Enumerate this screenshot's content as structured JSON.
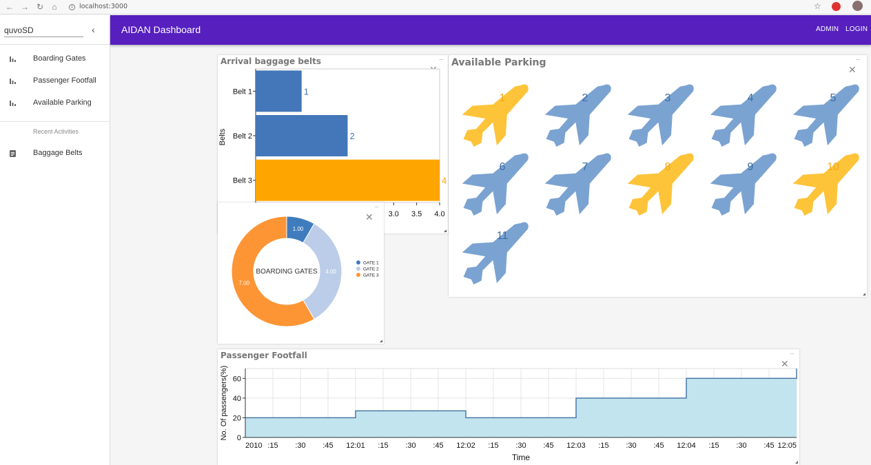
{
  "browser": {
    "url": "localhost:3000"
  },
  "sidebar": {
    "user": "quvoSD",
    "items": [
      {
        "label": "Boarding Gates",
        "icon": "bar-chart-icon"
      },
      {
        "label": "Passenger Footfall",
        "icon": "bar-chart-icon"
      },
      {
        "label": "Available Parking",
        "icon": "bar-chart-icon"
      }
    ],
    "section_title": "Recent Activities",
    "recent": [
      {
        "label": "Baggage Belts",
        "icon": "clipboard-icon"
      }
    ]
  },
  "appbar": {
    "title": "AIDAN Dashboard",
    "admin": "ADMIN",
    "login": "LOGIN",
    "color": "#561fbe"
  },
  "widgets": {
    "baggage": {
      "title": "Arrival baggage belts"
    },
    "parking": {
      "title": "Available Parking"
    },
    "gates": {
      "title": ""
    },
    "footfall": {
      "title": "Passenger Footfall"
    }
  },
  "chart_data": [
    {
      "type": "bar",
      "orientation": "horizontal",
      "title": "Arrival baggage belts",
      "ylabel": "Belts",
      "categories": [
        "Belt 1",
        "Belt 2",
        "Belt 3"
      ],
      "values": [
        1,
        2,
        4
      ],
      "colors": [
        "#4477b9",
        "#4477b9",
        "#ffa500"
      ],
      "xlim": [
        0,
        4.0
      ],
      "x_ticks_visible": [
        "3.0",
        "3.5",
        "4.0"
      ]
    },
    {
      "type": "pie",
      "variant": "donut",
      "center_label": "BOARDING GATES",
      "slices": [
        {
          "name": "GATE 1",
          "value": 1,
          "label": "1.00",
          "color": "#3f7cbd"
        },
        {
          "name": "GATE 2",
          "value": 4,
          "label": "4.00",
          "color": "#bccde9"
        },
        {
          "name": "GATE 3",
          "value": 7,
          "label": "7.00",
          "color": "#fd9535"
        }
      ],
      "legend": "right"
    },
    {
      "type": "area",
      "title": "Passenger Footfall",
      "xlabel": "Time",
      "ylabel": "No. Of passengers(%)",
      "x_ticks": [
        "2010",
        ":15",
        ":30",
        ":45",
        "12:01",
        ":15",
        ":30",
        ":45",
        "12:02",
        ":15",
        ":30",
        ":45",
        "12:03",
        ":15",
        ":30",
        ":45",
        "12:04",
        ":15",
        ":30",
        ":45",
        "12:05"
      ],
      "steps": [
        {
          "from": "12:00",
          "to": "12:01",
          "value": 20
        },
        {
          "from": "12:01",
          "to": "12:02",
          "value": 27
        },
        {
          "from": "12:02",
          "to": "12:03",
          "value": 20
        },
        {
          "from": "12:03",
          "to": "12:04",
          "value": 40
        },
        {
          "from": "12:04",
          "to": "12:05",
          "value": 60
        },
        {
          "from": "12:05",
          "to": "12:05",
          "value": 70
        }
      ],
      "ylim": [
        0,
        70
      ],
      "y_ticks": [
        0,
        20,
        40,
        60
      ],
      "grid": true,
      "fill_color": "#bfe3ee",
      "line_color": "#4a7aa7"
    }
  ],
  "parking": {
    "spots": [
      {
        "label": "1",
        "status": "occupied"
      },
      {
        "label": "2",
        "status": "available"
      },
      {
        "label": "3",
        "status": "available"
      },
      {
        "label": "4",
        "status": "available"
      },
      {
        "label": "5",
        "status": "available"
      },
      {
        "label": "6",
        "status": "available"
      },
      {
        "label": "7",
        "status": "available"
      },
      {
        "label": "8",
        "status": "occupied"
      },
      {
        "label": "9",
        "status": "available"
      },
      {
        "label": "10",
        "status": "occupied"
      },
      {
        "label": "11",
        "status": "available"
      }
    ],
    "colors": {
      "available": "#7ba3d1",
      "available_text": "#3c6da2",
      "occupied": "#fdc43a",
      "occupied_text": "#f0a919"
    }
  }
}
